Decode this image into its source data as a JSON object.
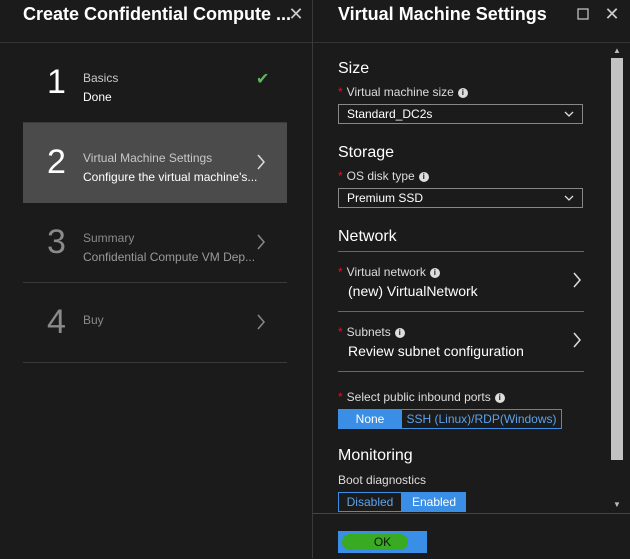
{
  "left_blade": {
    "title": "Create Confidential Compute ...",
    "steps": [
      {
        "num": "1",
        "title": "Basics",
        "subtitle": "Done",
        "state": "done"
      },
      {
        "num": "2",
        "title": "Virtual Machine Settings",
        "subtitle": "Configure the virtual machine's...",
        "state": "active"
      },
      {
        "num": "3",
        "title": "Summary",
        "subtitle": "Confidential Compute VM Dep...",
        "state": "pending"
      },
      {
        "num": "4",
        "title": "Buy",
        "subtitle": "",
        "state": "pending"
      }
    ]
  },
  "right_blade": {
    "title": "Virtual Machine Settings",
    "size": {
      "section": "Size",
      "label": "Virtual machine size",
      "value": "Standard_DC2s"
    },
    "storage": {
      "section": "Storage",
      "label": "OS disk type",
      "value": "Premium SSD"
    },
    "network": {
      "section": "Network",
      "vnet": {
        "label": "Virtual network",
        "value": "(new) VirtualNetwork"
      },
      "subnets": {
        "label": "Subnets",
        "value": "Review subnet configuration"
      },
      "ports": {
        "label": "Select public inbound ports",
        "options": [
          "None",
          "SSH (Linux)/RDP(Windows)"
        ],
        "selected": "None"
      }
    },
    "monitoring": {
      "section": "Monitoring",
      "label": "Boot diagnostics",
      "options": [
        "Disabled",
        "Enabled"
      ],
      "selected": "Enabled"
    },
    "ok_label": "OK"
  },
  "colors": {
    "accent": "#3a8ee6",
    "check": "#5cb85c",
    "required": "#e81123"
  }
}
